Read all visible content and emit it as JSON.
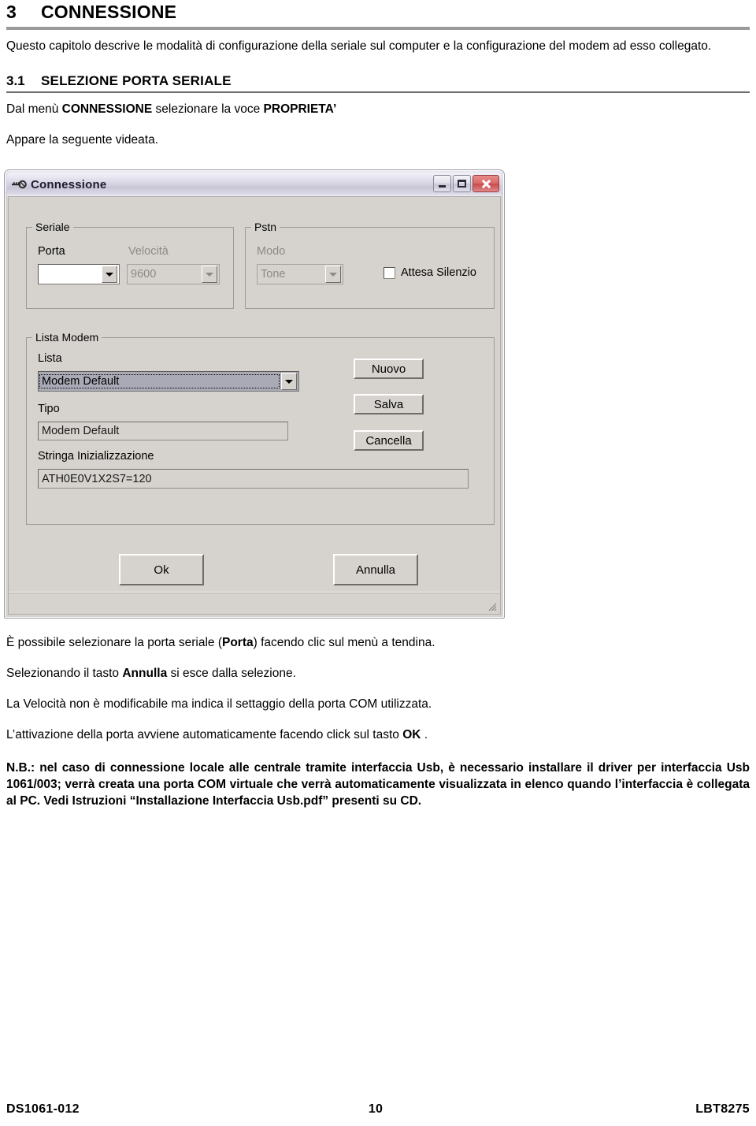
{
  "document": {
    "heading1": {
      "number": "3",
      "text": "CONNESSIONE"
    },
    "intro": "Questo capitolo descrive le modalità di configurazione della seriale sul computer e la configurazione del modem ad esso collegato.",
    "heading2": {
      "number": "3.1",
      "text": "SELEZIONE PORTA SERIALE"
    },
    "para_menu_pre": "Dal menù ",
    "para_menu_bold1": "CONNESSIONE",
    "para_menu_mid": " selezionare la voce ",
    "para_menu_bold2": "PROPRIETA’",
    "para_appare": "Appare la seguente videata.",
    "para_porta_pre": "È possibile selezionare la porta seriale (",
    "para_porta_bold": "Porta",
    "para_porta_post": ") facendo clic sul menù a tendina.",
    "para_annulla_pre": "Selezionando il tasto ",
    "para_annulla_bold": "Annulla",
    "para_annulla_post": " si esce dalla selezione.",
    "para_velocita": "La Velocità non è modificabile ma indica il settaggio della porta COM utilizzata.",
    "para_ok_pre": "L’attivazione della porta avviene automaticamente facendo click sul tasto ",
    "para_ok_bold": "OK",
    "para_ok_post": " .",
    "nota_bene": "N.B.: nel caso di connessione locale alle centrale tramite interfaccia Usb, è necessario installare il driver per interfaccia Usb 1061/003; verrà creata una porta COM virtuale che verrà automaticamente visualizzata in elenco quando l’interfaccia è collegata al PC.  Vedi Istruzioni “Installazione Interfaccia Usb.pdf” presenti su CD."
  },
  "dialog": {
    "title": "Connessione",
    "title_icon": "key-icon",
    "window_buttons": {
      "minimize": "minimize-icon",
      "maximize": "maximize-icon",
      "close": "close-icon"
    },
    "groups": {
      "seriale": {
        "legend": "Seriale",
        "porta_label": "Porta",
        "porta_value": "",
        "velocita_label": "Velocità",
        "velocita_value": "9600"
      },
      "pstn": {
        "legend": "Pstn",
        "modo_label": "Modo",
        "modo_value": "Tone",
        "attesa_label": "Attesa Silenzio",
        "attesa_checked": false
      },
      "lista_modem": {
        "legend": "Lista Modem",
        "lista_label": "Lista",
        "lista_value": "Modem Default",
        "tipo_label": "Tipo",
        "tipo_value": "Modem Default",
        "stringa_label": "Stringa Inizializzazione",
        "stringa_value": "ATH0E0V1X2S7=120",
        "btn_nuovo": "Nuovo",
        "btn_salva": "Salva",
        "btn_cancella": "Cancella"
      }
    },
    "btn_ok": "Ok",
    "btn_annulla": "Annulla"
  },
  "footer": {
    "left": "DS1061-012",
    "center": "10",
    "right": "LBT8275"
  },
  "colors": {
    "rule_thick": "#9a9a9a",
    "rule_thin": "#6d6d6d",
    "dialog_face": "#d6d3ce",
    "close_red": "#dc6a6a",
    "combo_focus": "#a9aab6"
  }
}
